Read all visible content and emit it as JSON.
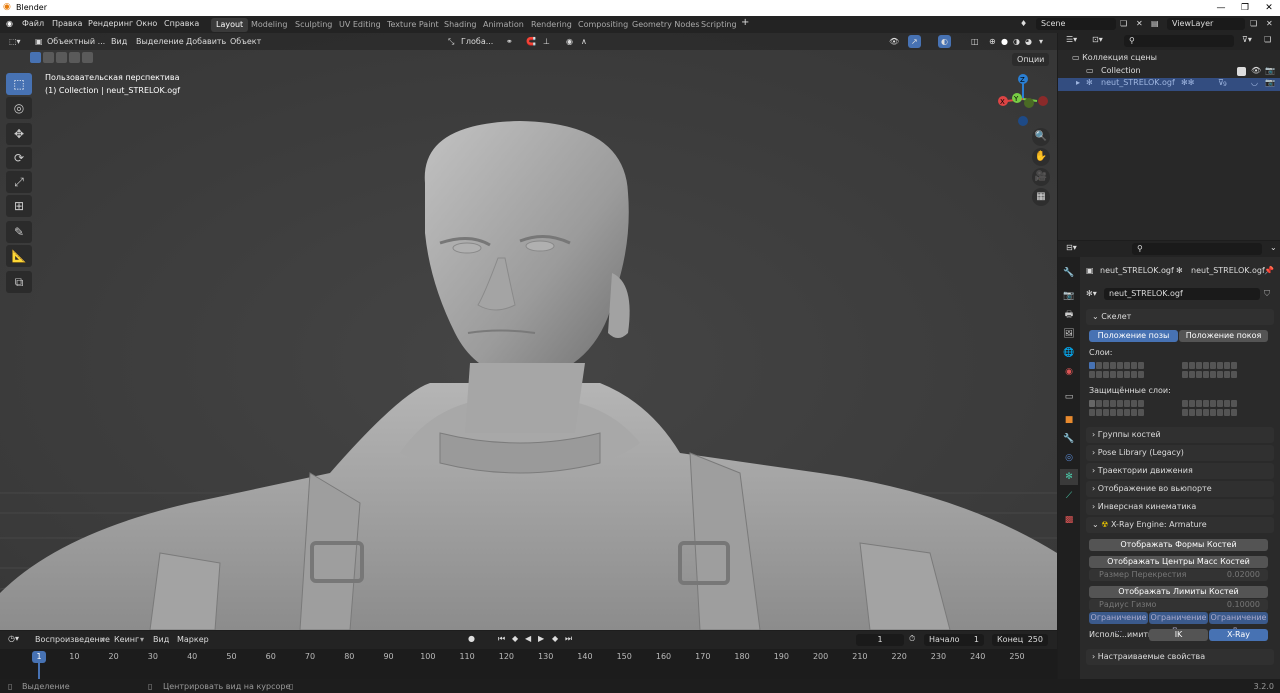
{
  "window": {
    "title": "Blender"
  },
  "menu": [
    "Файл",
    "Правка",
    "Рендеринг",
    "Окно",
    "Справка"
  ],
  "workspaces": [
    "Layout",
    "Modeling",
    "Sculpting",
    "UV Editing",
    "Texture Paint",
    "Shading",
    "Animation",
    "Rendering",
    "Compositing",
    "Geometry Nodes",
    "Scripting"
  ],
  "scene": "Scene",
  "viewlayer": "ViewLayer",
  "viewport": {
    "mode": "Объектный ...",
    "menu": [
      "Вид",
      "Выделение",
      "Добавить",
      "Объект"
    ],
    "orientation": "Глоба...",
    "options": "Опции",
    "info_line1": "Пользовательская перспектива",
    "info_line2": "(1) Collection | neut_STRELOK.ogf"
  },
  "outliner": {
    "scene_collection": "Коллекция сцены",
    "collection": "Collection",
    "object": "neut_STRELOK.ogf",
    "badge": "9"
  },
  "properties": {
    "breadcrumb1": "neut_STRELOK.ogf",
    "breadcrumb2": "neut_STRELOK.ogf",
    "data_name": "neut_STRELOK.ogf",
    "skeleton": "Скелет",
    "pose_position": "Положение позы",
    "rest_position": "Положение покоя",
    "layers": "Слои:",
    "protected_layers": "Защищённые слои:",
    "sections": [
      "Группы костей",
      "Pose Library (Legacy)",
      "Траектории движения",
      "Отображение во вьюпорте",
      "Инверсная кинематика"
    ],
    "xray_title": "X-Ray Engine: Armature",
    "show_shapes": "Отображать Формы Костей",
    "show_mass": "Отображать Центры Масс Костей",
    "cross_size_label": "Размер Перекрестия",
    "cross_size": "0.02000",
    "show_limits": "Отображать Лимиты Костей",
    "gizmo_radius_label": "Радиус Гизмо",
    "gizmo_radius": "0.10000",
    "limit_btns": [
      "Ограничение ...",
      "Ограничение п...",
      "Ограничение л..."
    ],
    "use_limits": "Исполь...имиты:",
    "ik": "IK",
    "xray": "X-Ray",
    "custom_props": "Настраиваемые свойства"
  },
  "timeline": {
    "menu": [
      "Воспроизведение",
      "Кеинг",
      "Вид",
      "Маркер"
    ],
    "current_frame": "1",
    "start_label": "Начало",
    "start": "1",
    "end_label": "Конец",
    "end": "250",
    "ticks": [
      "1",
      "10",
      "20",
      "30",
      "40",
      "50",
      "60",
      "70",
      "80",
      "90",
      "100",
      "110",
      "120",
      "130",
      "140",
      "150",
      "160",
      "170",
      "180",
      "190",
      "200",
      "210",
      "220",
      "230",
      "240",
      "250"
    ]
  },
  "status": {
    "left": "Выделение",
    "middle": "Центрировать вид на курсоре",
    "version": "3.2.0"
  }
}
